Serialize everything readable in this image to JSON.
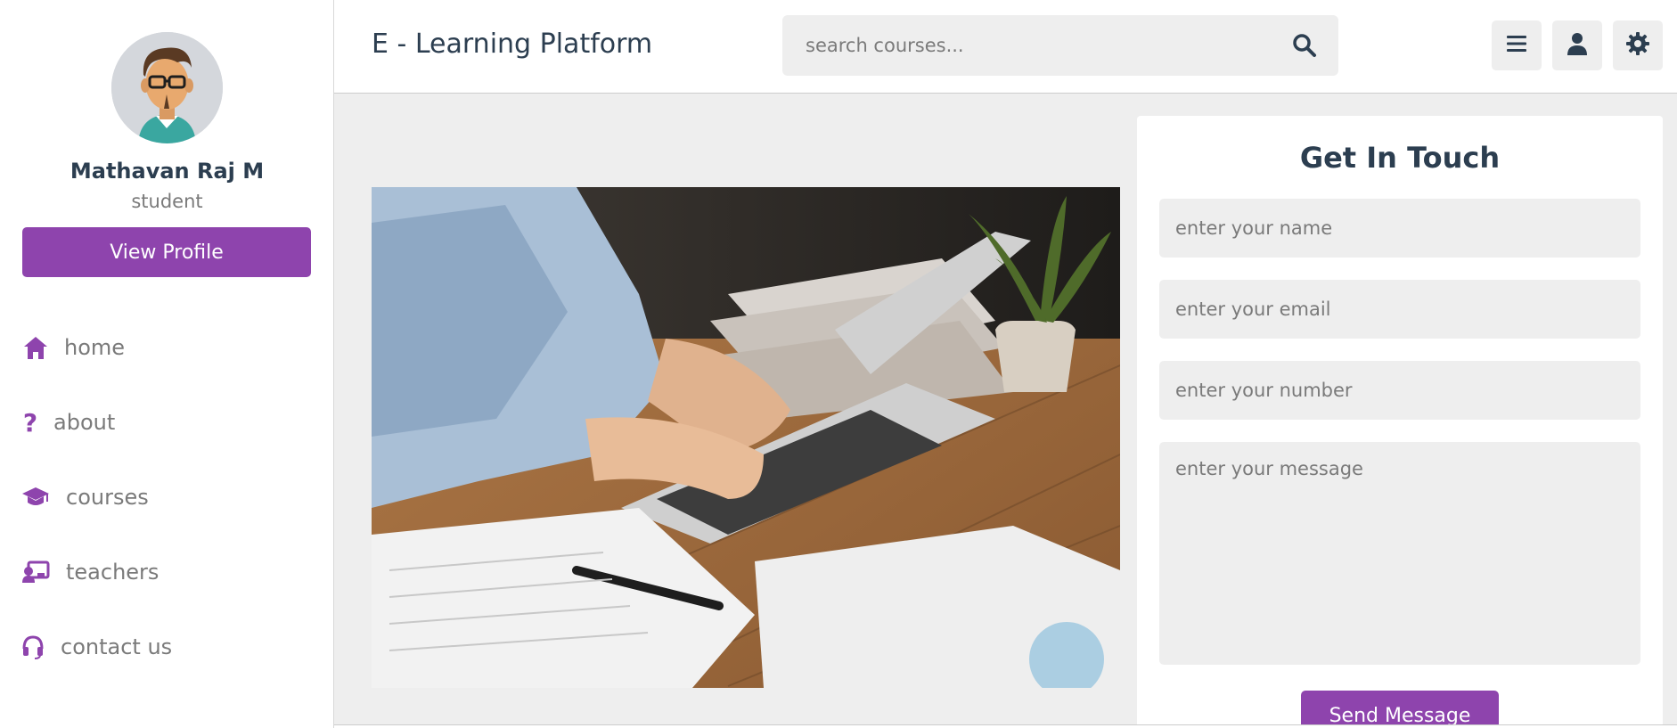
{
  "colors": {
    "accent": "#8e44ad",
    "text_dark": "#2c3e50",
    "text_muted": "#7a7a7a",
    "background": "#eeeeee",
    "panel": "#ffffff"
  },
  "header": {
    "logo": "E - Learning Platform",
    "search_placeholder": "search courses...",
    "search_icon": "search-icon",
    "buttons": [
      {
        "icon": "menu-icon"
      },
      {
        "icon": "user-icon"
      },
      {
        "icon": "gear-icon"
      }
    ]
  },
  "sidebar": {
    "avatar_icon": "user-avatar",
    "name": "Mathavan Raj M",
    "role": "student",
    "view_profile_label": "View Profile",
    "items": [
      {
        "label": "home",
        "icon": "home-icon"
      },
      {
        "label": "about",
        "icon": "question-icon"
      },
      {
        "label": "courses",
        "icon": "graduation-cap-icon"
      },
      {
        "label": "teachers",
        "icon": "teacher-icon"
      },
      {
        "label": "contact us",
        "icon": "headset-icon"
      }
    ]
  },
  "main": {
    "hero_image": "photo of hands typing on a laptop at a wooden desk",
    "contact": {
      "title": "Get In Touch",
      "name_placeholder": "enter your name",
      "email_placeholder": "enter your email",
      "number_placeholder": "enter your number",
      "message_placeholder": "enter your message",
      "send_label": "Send Message"
    }
  }
}
